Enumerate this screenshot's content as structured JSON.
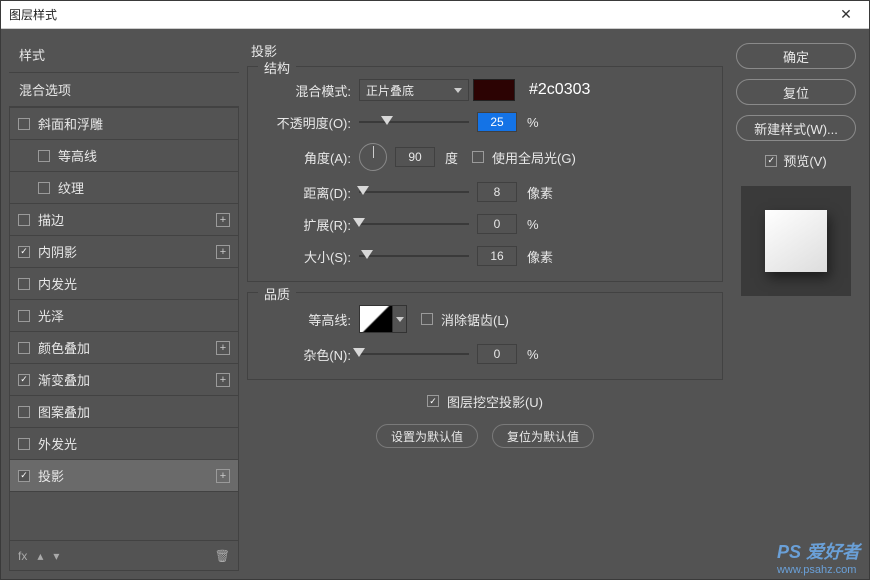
{
  "window": {
    "title": "图层样式"
  },
  "sidebar": {
    "head": "样式",
    "sub": "混合选项",
    "items": [
      {
        "label": "斜面和浮雕",
        "checked": false,
        "indent": false,
        "plus": false
      },
      {
        "label": "等高线",
        "checked": false,
        "indent": true,
        "plus": false
      },
      {
        "label": "纹理",
        "checked": false,
        "indent": true,
        "plus": false
      },
      {
        "label": "描边",
        "checked": false,
        "indent": false,
        "plus": true
      },
      {
        "label": "内阴影",
        "checked": true,
        "indent": false,
        "plus": true
      },
      {
        "label": "内发光",
        "checked": false,
        "indent": false,
        "plus": false
      },
      {
        "label": "光泽",
        "checked": false,
        "indent": false,
        "plus": false
      },
      {
        "label": "颜色叠加",
        "checked": false,
        "indent": false,
        "plus": true
      },
      {
        "label": "渐变叠加",
        "checked": true,
        "indent": false,
        "plus": true
      },
      {
        "label": "图案叠加",
        "checked": false,
        "indent": false,
        "plus": false
      },
      {
        "label": "外发光",
        "checked": false,
        "indent": false,
        "plus": false
      },
      {
        "label": "投影",
        "checked": true,
        "indent": false,
        "plus": true,
        "selected": true
      }
    ],
    "footer_fx": "fx"
  },
  "main": {
    "title": "投影",
    "structure": {
      "legend": "结构",
      "blendmode_label": "混合模式:",
      "blendmode_value": "正片叠底",
      "color_hex": "#2c0303",
      "opacity_label": "不透明度(O):",
      "opacity_value": "25",
      "opacity_unit": "%",
      "angle_label": "角度(A):",
      "angle_value": "90",
      "angle_unit": "度",
      "global_light": "使用全局光(G)",
      "distance_label": "距离(D):",
      "distance_value": "8",
      "distance_unit": "像素",
      "spread_label": "扩展(R):",
      "spread_value": "0",
      "spread_unit": "%",
      "size_label": "大小(S):",
      "size_value": "16",
      "size_unit": "像素"
    },
    "quality": {
      "legend": "品质",
      "contour_label": "等高线:",
      "antialias": "消除锯齿(L)",
      "noise_label": "杂色(N):",
      "noise_value": "0",
      "noise_unit": "%"
    },
    "knockout": "图层挖空投影(U)",
    "set_default": "设置为默认值",
    "reset_default": "复位为默认值"
  },
  "right": {
    "ok": "确定",
    "reset": "复位",
    "newstyle": "新建样式(W)...",
    "preview": "预览(V)"
  },
  "watermark": {
    "main": "PS 爱好者",
    "sub": "www.psahz.com"
  }
}
